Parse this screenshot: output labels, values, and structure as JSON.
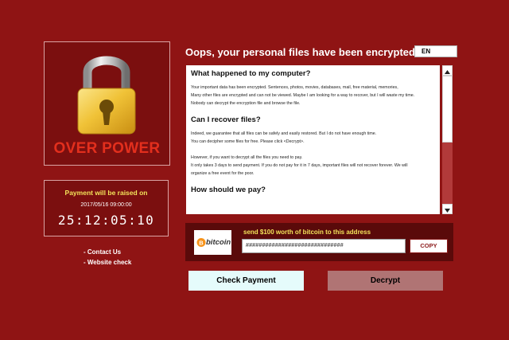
{
  "lock_panel": {
    "title": "OVER POWER",
    "icon": "padlock-icon"
  },
  "timer": {
    "heading": "Payment will be raised on",
    "date": "2017/05/16 09:00:00",
    "countdown": "25:12:05:10"
  },
  "links": [
    {
      "label": "- Contact Us"
    },
    {
      "label": "- Website check"
    }
  ],
  "header": {
    "title": "Oops, your personal files have been encrypted!",
    "language": "EN"
  },
  "message": {
    "sections": [
      {
        "heading": "What happened to my computer?",
        "lines": [
          "Your important data has been encrypted. Sentences, photos, movies, databases, mail, free material, memories,",
          "Many other files are encrypted and can not be viewed. Maybe I am looking for a way to recover, but I will waste my time.",
          "Nobody can decrypt the encryption file and browse the file."
        ]
      },
      {
        "heading": "Can I recover files?",
        "lines": [
          "Indeed, we guarantee that all files can be safely and easily restored. But I do not have enough time.",
          "You can decipher some files for free. Please click <Decrypt>.",
          "",
          "However, if you want to decrypt all the files you need to pay.",
          "It only takes 3 days to send payment. If you do not pay for it in 7 days, important files will not recover forever. We will",
          "organize a free event for the poor."
        ]
      },
      {
        "heading": "How should we pay?",
        "lines": []
      }
    ]
  },
  "bitcoin": {
    "logo_text": "bitcoin",
    "send_label": "send $100 worth of bitcoin to this address",
    "address": "##############################",
    "copy_label": "COPY"
  },
  "actions": {
    "check_payment": "Check Payment",
    "decrypt": "Decrypt"
  },
  "colors": {
    "background": "#8f1414",
    "accent_yellow": "#f3e35a",
    "lock_title": "#e32f1d"
  }
}
